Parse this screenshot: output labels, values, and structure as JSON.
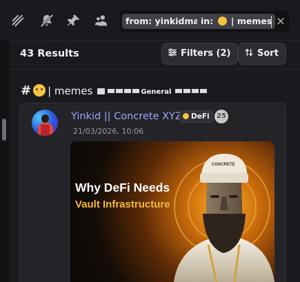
{
  "toolbar": {
    "icons": [
      "threads-icon",
      "notifications-muted-icon",
      "pin-icon",
      "members-icon"
    ]
  },
  "search": {
    "from_key": "from:",
    "from_value": "yinkidmax",
    "in_key": "in:",
    "in_emoji": "grinning-sweat-emoji",
    "in_value": "| memes",
    "clear_icon": "×"
  },
  "results": {
    "count_label": "43 Results",
    "filters_label": "Filters (2)",
    "sort_label": "Sort"
  },
  "channel": {
    "hash": "#",
    "emoji": "grinning-sweat-emoji",
    "name": "| memes",
    "category": "General"
  },
  "message": {
    "username": "Yinkid || Concrete XYZ",
    "tag": "DeFi",
    "level": "25",
    "timestamp": "21/03/2026, 10:06",
    "image": {
      "headline_line1": "Why DeFi Needs",
      "headline_line2": "Vault Infrastructure",
      "hat_text": "CONCRETE"
    }
  },
  "colors": {
    "accent_username": "#9ea3ff",
    "headline_accent": "#f3b93a",
    "background": "#1a1a1e"
  }
}
